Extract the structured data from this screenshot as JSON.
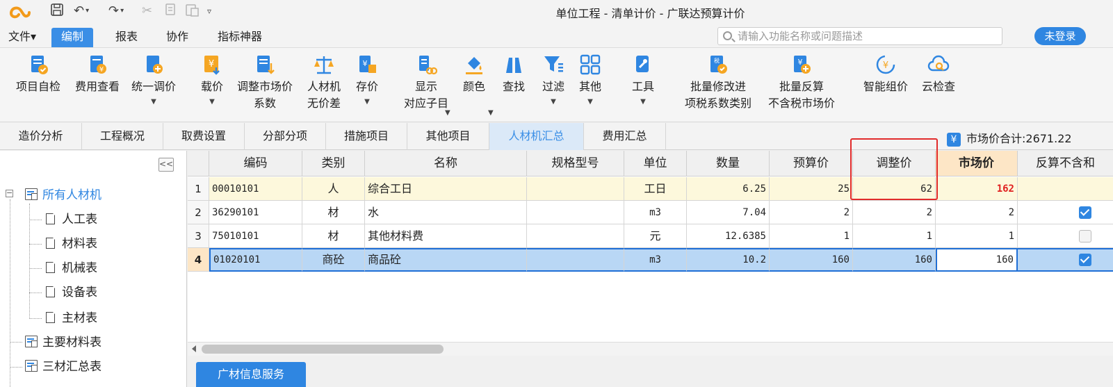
{
  "window": {
    "title": "单位工程 - 清单计价 - 广联达预算计价"
  },
  "menu": {
    "items": [
      "文件▾",
      "编制",
      "报表",
      "协作",
      "指标神器"
    ],
    "search_placeholder": "请输入功能名称或问题描述",
    "login_label": "未登录"
  },
  "ribbon": {
    "tools": [
      {
        "line1": "项目自检",
        "line2": ""
      },
      {
        "line1": "费用查看",
        "line2": ""
      },
      {
        "line1": "统一调价",
        "line2": ""
      },
      {
        "line1": "载价",
        "line2": ""
      },
      {
        "line1": "调整市场价",
        "line2": "系数"
      },
      {
        "line1": "人材机",
        "line2": "无价差"
      },
      {
        "line1": "存价",
        "line2": ""
      },
      {
        "line1": "显示",
        "line2": "对应子目"
      },
      {
        "line1": "颜色",
        "line2": ""
      },
      {
        "line1": "查找",
        "line2": ""
      },
      {
        "line1": "过滤",
        "line2": ""
      },
      {
        "line1": "其他",
        "line2": ""
      },
      {
        "line1": "工具",
        "line2": ""
      },
      {
        "line1": "批量修改进",
        "line2": "项税系数类别"
      },
      {
        "line1": "批量反算",
        "line2": "不含税市场价"
      },
      {
        "line1": "智能组价",
        "line2": ""
      },
      {
        "line1": "云检查",
        "line2": ""
      }
    ]
  },
  "tabs": [
    "造价分析",
    "工程概况",
    "取费设置",
    "分部分项",
    "措施项目",
    "其他项目",
    "人材机汇总",
    "费用汇总"
  ],
  "summary": {
    "icon": "¥",
    "market_total": "市场价合计:2671.22"
  },
  "tree": {
    "root": "所有人材机",
    "children": [
      "人工表",
      "材料表",
      "机械表",
      "设备表",
      "主材表"
    ],
    "others": [
      "主要材料表",
      "三材汇总表"
    ]
  },
  "grid": {
    "headers": [
      "编码",
      "类别",
      "名称",
      "规格型号",
      "单位",
      "数量",
      "预算价",
      "调整价",
      "市场价",
      "反算不含和"
    ],
    "rows": [
      {
        "no": "1",
        "code": "00010101",
        "type": "人",
        "name": "综合工日",
        "spec": "",
        "unit": "工日",
        "qty": "6.25",
        "budget": "25",
        "adjust": "62",
        "market": "162",
        "check": "none"
      },
      {
        "no": "2",
        "code": "36290101",
        "type": "材",
        "name": "水",
        "spec": "",
        "unit": "m3",
        "qty": "7.04",
        "budget": "2",
        "adjust": "2",
        "market": "2",
        "check": "on"
      },
      {
        "no": "3",
        "code": "75010101",
        "type": "材",
        "name": "其他材料费",
        "spec": "",
        "unit": "元",
        "qty": "12.6385",
        "budget": "1",
        "adjust": "1",
        "market": "1",
        "check": "off"
      },
      {
        "no": "4",
        "code": "01020101",
        "type": "商砼",
        "name": "商品砼",
        "spec": "",
        "unit": "m3",
        "qty": "10.2",
        "budget": "160",
        "adjust": "160",
        "market": "160",
        "check": "on"
      }
    ]
  },
  "footer": {
    "service_button": "广材信息服务"
  }
}
